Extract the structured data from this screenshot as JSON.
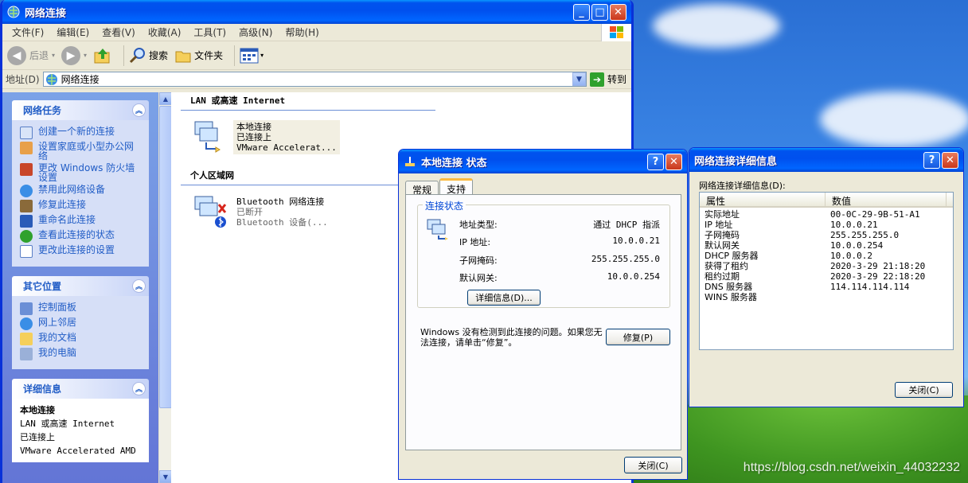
{
  "explorer": {
    "title": "网络连接",
    "menu": [
      "文件(F)",
      "编辑(E)",
      "查看(V)",
      "收藏(A)",
      "工具(T)",
      "高级(N)",
      "帮助(H)"
    ],
    "toolbar": {
      "back": "后退",
      "search": "搜索",
      "folders": "文件夹"
    },
    "address": {
      "label": "地址(D)",
      "value": "网络连接",
      "go": "转到"
    },
    "left": {
      "network_tasks": {
        "title": "网络任务",
        "items": [
          "创建一个新的连接",
          "设置家庭或小型办公网络",
          "更改 Windows 防火墙设置",
          "禁用此网络设备",
          "修复此连接",
          "重命名此连接",
          "查看此连接的状态",
          "更改此连接的设置"
        ]
      },
      "other_places": {
        "title": "其它位置",
        "items": [
          "控制面板",
          "网上邻居",
          "我的文档",
          "我的电脑"
        ]
      },
      "details": {
        "title": "详细信息",
        "name": "本地连接",
        "lines": [
          "LAN 或高速 Internet",
          "已连接上",
          "VMware Accelerated AMD"
        ]
      }
    },
    "groups": [
      {
        "header": "LAN 或高速 Internet",
        "item": {
          "name": "本地连接",
          "status": "已连接上",
          "device": "VMware Accelerat..."
        }
      },
      {
        "header": "个人区域网",
        "item": {
          "name": "Bluetooth 网络连接",
          "status": "已断开",
          "device": "Bluetooth 设备(..."
        }
      }
    ]
  },
  "status_dialog": {
    "title": "本地连接 状态",
    "tabs": [
      "常规",
      "支持"
    ],
    "group_title": "连接状态",
    "rows": [
      {
        "label": "地址类型:",
        "value": "通过 DHCP 指派"
      },
      {
        "label": "IP 地址:",
        "value": "10.0.0.21"
      },
      {
        "label": "子网掩码:",
        "value": "255.255.255.0"
      },
      {
        "label": "默认网关:",
        "value": "10.0.0.254"
      }
    ],
    "details_button": "详细信息(D)...",
    "message": "Windows 没有检测到此连接的问题。如果您无法连接，请单击“修复”。",
    "repair_button": "修复(P)",
    "close_button": "关闭(C)"
  },
  "details_dialog": {
    "title": "网络连接详细信息",
    "label": "网络连接详细信息(D):",
    "col_property": "属性",
    "col_value": "数值",
    "rows": [
      {
        "p": "实际地址",
        "v": "00-0C-29-9B-51-A1"
      },
      {
        "p": "IP 地址",
        "v": "10.0.0.21"
      },
      {
        "p": "子网掩码",
        "v": "255.255.255.0"
      },
      {
        "p": "默认网关",
        "v": "10.0.0.254"
      },
      {
        "p": "DHCP 服务器",
        "v": "10.0.0.2"
      },
      {
        "p": "获得了租约",
        "v": "2020-3-29 21:18:20"
      },
      {
        "p": "租约过期",
        "v": "2020-3-29 22:18:20"
      },
      {
        "p": "DNS 服务器",
        "v": "114.114.114.114"
      },
      {
        "p": "WINS 服务器",
        "v": ""
      }
    ],
    "close_button": "关闭(C)"
  },
  "watermark": "https://blog.csdn.net/weixin_44032232"
}
